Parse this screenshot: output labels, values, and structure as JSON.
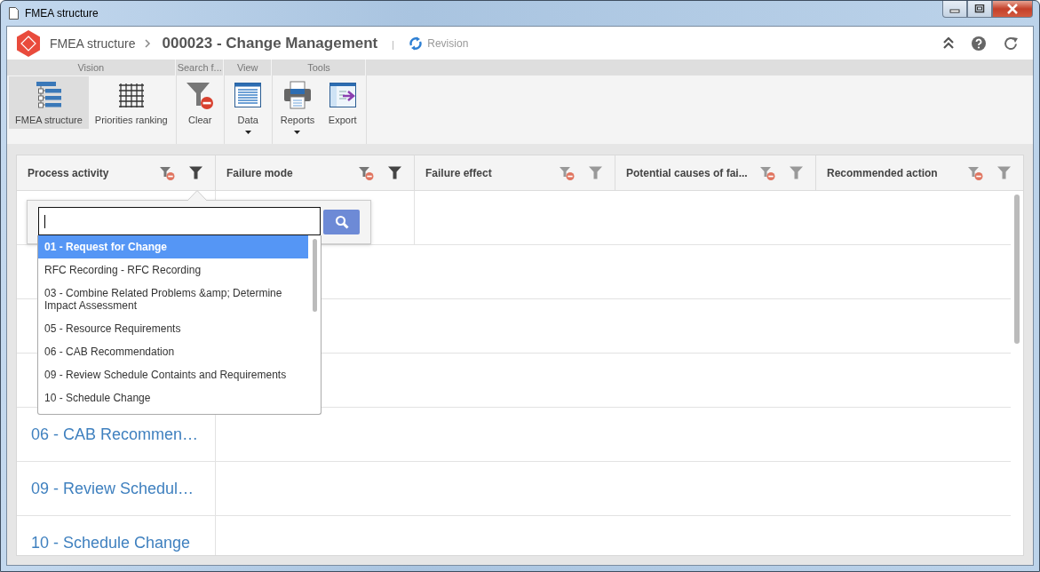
{
  "window": {
    "title": "FMEA structure"
  },
  "header": {
    "root": "FMEA structure",
    "current": "000023 - Change Management",
    "action": "Revision"
  },
  "ribbon": {
    "groups": [
      {
        "label": "Vision",
        "items": [
          {
            "label": "FMEA structure",
            "kind": "tree",
            "selected": true,
            "dropdown": false
          },
          {
            "label": "Priorities ranking",
            "kind": "grid",
            "selected": false,
            "dropdown": false
          }
        ]
      },
      {
        "label": "Search f...",
        "items": [
          {
            "label": "Clear",
            "kind": "clear",
            "selected": false,
            "dropdown": false
          }
        ]
      },
      {
        "label": "View",
        "items": [
          {
            "label": "Data",
            "kind": "data",
            "selected": false,
            "dropdown": true
          }
        ]
      },
      {
        "label": "Tools",
        "items": [
          {
            "label": "Reports",
            "kind": "printer",
            "selected": false,
            "dropdown": true
          },
          {
            "label": "Export",
            "kind": "export",
            "selected": false,
            "dropdown": false
          }
        ]
      }
    ]
  },
  "table": {
    "columns": [
      {
        "label": "Process activity",
        "highlighted": true
      },
      {
        "label": "Failure mode",
        "highlighted": true
      },
      {
        "label": "Failure effect",
        "highlighted": false
      },
      {
        "label": "Potential causes of fai...",
        "highlighted": false
      },
      {
        "label": "Recommended action",
        "highlighted": false
      }
    ],
    "rows": [
      {
        "kind": "split"
      },
      {
        "kind": "plain"
      },
      {
        "kind": "plain"
      },
      {
        "kind": "plain"
      },
      {
        "kind": "plain",
        "process_activity": "06 - CAB Recommen…"
      },
      {
        "kind": "plain",
        "process_activity": "09 - Review Schedul…"
      },
      {
        "kind": "plain",
        "process_activity": "10 - Schedule Change"
      }
    ]
  },
  "filter_popup": {
    "options": [
      {
        "label": "01 - Request for Change",
        "selected": true
      },
      {
        "label": "RFC Recording - RFC Recording",
        "selected": false
      },
      {
        "label": "03 - Combine Related Problems &amp; Determine Impact Assessment",
        "selected": false
      },
      {
        "label": "05 - Resource Requirements",
        "selected": false
      },
      {
        "label": "06 - CAB Recommendation",
        "selected": false
      },
      {
        "label": "09 - Review Schedule Containts and Requirements",
        "selected": false
      },
      {
        "label": "10 - Schedule Change",
        "selected": false
      }
    ]
  }
}
